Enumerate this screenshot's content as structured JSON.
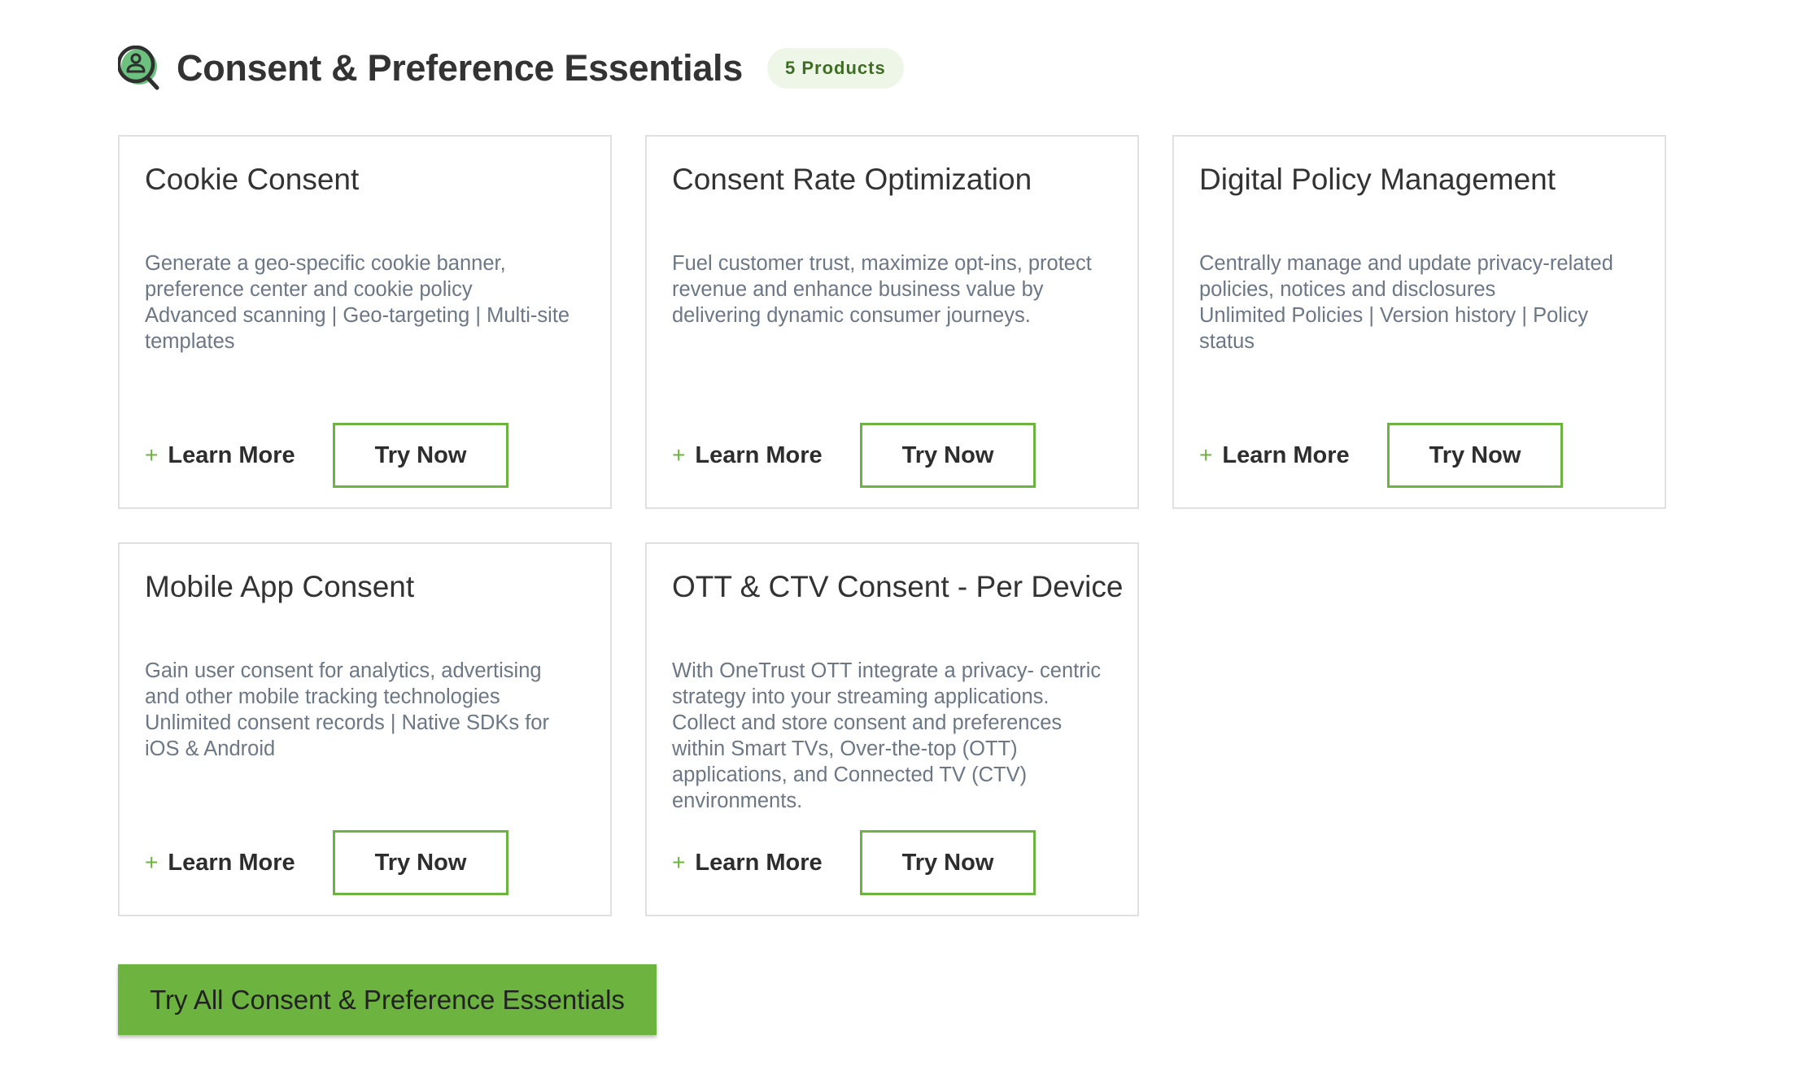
{
  "header": {
    "icon": "user-search-icon",
    "title": "Consent & Preference Essentials",
    "badge": "5 Products"
  },
  "colors": {
    "accent": "#6db33f",
    "badge_bg": "#eef6e7",
    "badge_text": "#3e6e24",
    "icon_fill": "#6cc17e",
    "title_text": "#333333",
    "description_text": "#6b7785",
    "card_border": "#e0e0e0"
  },
  "cards": [
    {
      "title": "Cookie Consent",
      "description_lines": [
        "Generate a geo-specific cookie banner,",
        "preference center and cookie policy",
        "Advanced scanning | Geo-targeting | Multi-site",
        "templates"
      ],
      "learn_more_icon": "plus-icon",
      "learn_more": "Learn More",
      "try_now": "Try Now"
    },
    {
      "title": "Consent Rate Optimization",
      "description_lines": [
        "Fuel customer trust, maximize opt-ins, protect",
        "revenue and enhance business value by",
        "delivering dynamic consumer journeys."
      ],
      "learn_more_icon": "plus-icon",
      "learn_more": "Learn More",
      "try_now": "Try Now"
    },
    {
      "title": "Digital Policy Management",
      "description_lines": [
        "Centrally manage and update privacy-related",
        "policies, notices and disclosures",
        "Unlimited Policies | Version history | Policy",
        "status"
      ],
      "learn_more_icon": "plus-icon",
      "learn_more": "Learn More",
      "try_now": "Try Now"
    },
    {
      "title": "Mobile App Consent",
      "description_lines": [
        "Gain user consent for analytics, advertising",
        "and other mobile tracking technologies",
        "Unlimited consent records | Native SDKs for",
        "iOS & Android"
      ],
      "learn_more_icon": "plus-icon",
      "learn_more": "Learn More",
      "try_now": "Try Now"
    },
    {
      "title": "OTT & CTV Consent - Per Device",
      "description_lines": [
        "With OneTrust OTT integrate a privacy- centric",
        "strategy into your streaming applications.",
        "Collect and store consent and preferences",
        "within Smart TVs, Over-the-top (OTT)",
        "applications, and Connected TV (CTV)",
        "environments."
      ],
      "learn_more_icon": "plus-icon",
      "learn_more": "Learn More",
      "try_now": "Try Now"
    }
  ],
  "try_all_button": "Try All Consent & Preference Essentials"
}
